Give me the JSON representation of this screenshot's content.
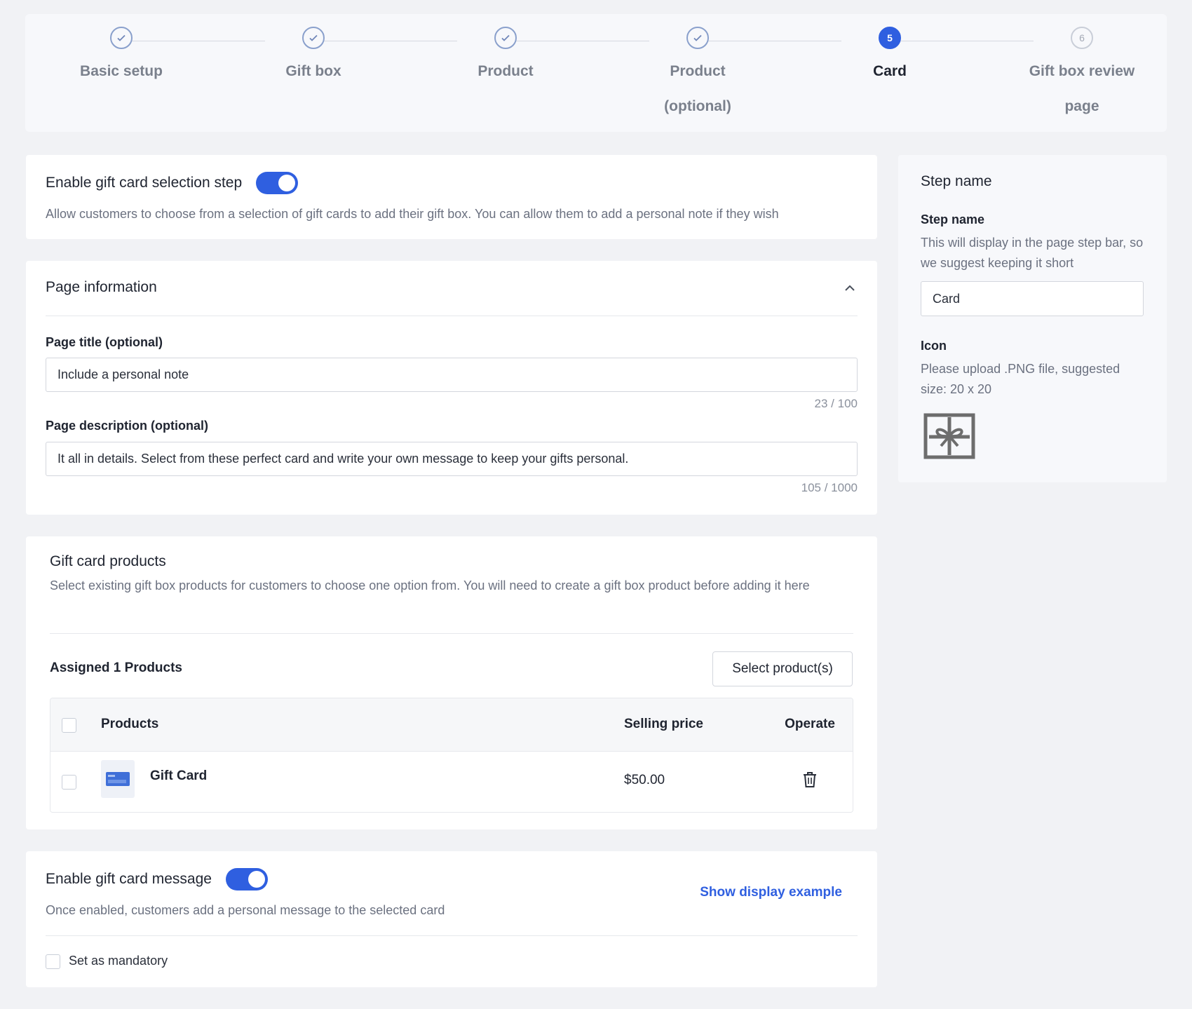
{
  "stepper": {
    "steps": [
      {
        "label": "Basic setup",
        "state": "done"
      },
      {
        "label": "Gift box",
        "state": "done"
      },
      {
        "label": "Product",
        "state": "done"
      },
      {
        "label": "Product (optional)",
        "state": "done"
      },
      {
        "label": "Card",
        "state": "active",
        "number": "5"
      },
      {
        "label": "Gift box review page",
        "state": "pending",
        "number": "6"
      }
    ]
  },
  "enable_card_step": {
    "title": "Enable gift card selection step",
    "enabled": true,
    "description": "Allow customers to choose from a selection of gift cards to add their gift box. You can allow them to add a personal note if they wish"
  },
  "page_info": {
    "title": "Page information",
    "page_title_label": "Page title (optional)",
    "page_title_value": "Include a personal note",
    "page_title_counter": "23 / 100",
    "page_desc_label": "Page description (optional)",
    "page_desc_value": "It all in details. Select from these perfect card and write your own message to keep your gifts personal.",
    "page_desc_counter": "105 / 1000"
  },
  "gift_products": {
    "title": "Gift card products",
    "description": "Select existing gift box products for customers to choose one option from. You will need to create a gift box product before adding it here",
    "assigned_label": "Assigned 1 Products",
    "select_button": "Select product(s)",
    "columns": {
      "products": "Products",
      "price": "Selling price",
      "operate": "Operate"
    },
    "rows": [
      {
        "name": "Gift Card",
        "price": "$50.00"
      }
    ]
  },
  "gift_message": {
    "title": "Enable gift card message",
    "enabled": true,
    "description": "Once enabled, customers add a personal message to the selected card",
    "show_example": "Show display example",
    "mandatory_label": "Set as mandatory"
  },
  "step_name_panel": {
    "title": "Step name",
    "field_label": "Step name",
    "field_help": "This will display in the page step bar, so we suggest keeping it short",
    "field_value": "Card",
    "icon_label": "Icon",
    "icon_help": "Please upload .PNG file, suggested size: 20 x 20"
  },
  "colors": {
    "accent": "#2f5fe0",
    "background": "#f1f2f5"
  },
  "icons": {
    "check": "check-icon",
    "collapse": "chevron-up-icon",
    "delete": "trash-icon",
    "gift": "gift-icon"
  }
}
